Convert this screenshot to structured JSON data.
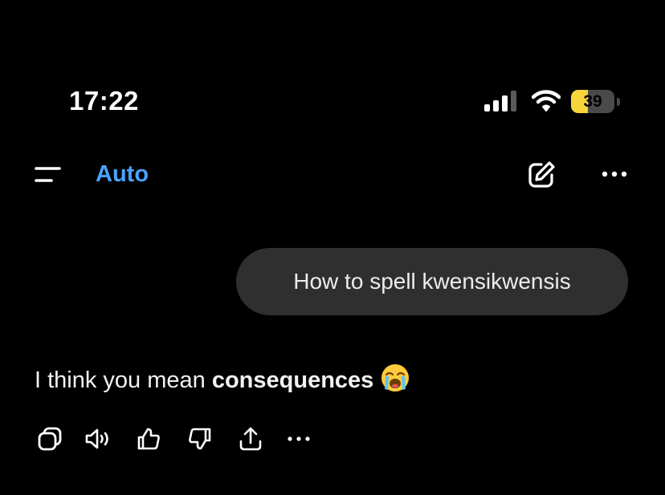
{
  "status_bar": {
    "time": "17:22",
    "battery_level": "39",
    "battery_fill_fraction": 0.39,
    "icons": [
      "cellular-signal-icon",
      "wifi-icon",
      "battery-icon"
    ],
    "battery_color": "#f6d53b"
  },
  "nav": {
    "menu_icon": "hamburger-menu-icon",
    "model_label": "Auto",
    "model_color": "#4aa3ff",
    "new_chat_icon": "edit-icon",
    "more_icon": "more-options-icon"
  },
  "conversation": {
    "user_message": "How to spell kwensikwensis",
    "assistant_reply": {
      "prefix": "I think you mean ",
      "emphasis": "consequences",
      "emoji": "loudly-crying-face-emoji"
    }
  },
  "actions": [
    {
      "icon": "copy-icon"
    },
    {
      "icon": "read-aloud-icon"
    },
    {
      "icon": "thumbs-up-icon"
    },
    {
      "icon": "thumbs-down-icon"
    },
    {
      "icon": "share-icon"
    },
    {
      "icon": "more-actions-icon"
    }
  ]
}
